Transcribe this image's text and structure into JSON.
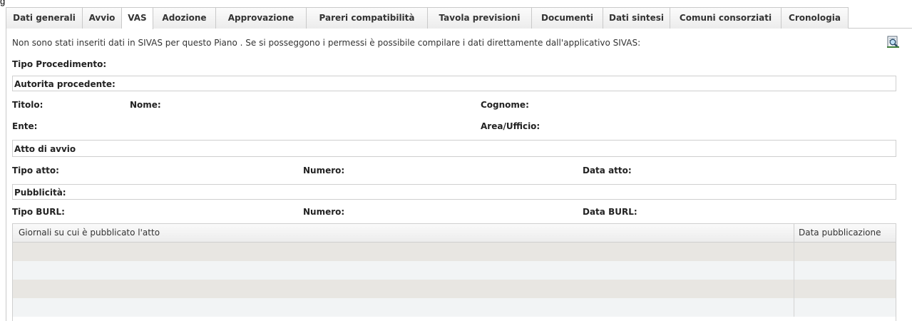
{
  "page_fragment": "g",
  "tabs": [
    {
      "label": "Dati generali",
      "active": false
    },
    {
      "label": "Avvio",
      "active": false
    },
    {
      "label": "VAS",
      "active": true
    },
    {
      "label": "Adozione",
      "active": false
    },
    {
      "label": "Approvazione",
      "active": false
    },
    {
      "label": "Pareri compatibilità",
      "active": false
    },
    {
      "label": "Tavola previsioni",
      "active": false
    },
    {
      "label": "Documenti",
      "active": false
    },
    {
      "label": "Dati sintesi",
      "active": false
    },
    {
      "label": "Comuni consorziati",
      "active": false
    },
    {
      "label": "Cronologia",
      "active": false
    }
  ],
  "notice": "Non sono stati inseriti dati in SIVAS per questo Piano . Se si posseggono i permessi è possibile compilare i dati direttamente dall'applicativo SIVAS:",
  "sivas_link_icon": "search-document-icon",
  "fields": {
    "tipo_procedimento": "Tipo Procedimento:",
    "autorita_procedente": "Autorita procedente:",
    "titolo": "Titolo:",
    "nome": "Nome:",
    "cognome": "Cognome:",
    "ente": "Ente:",
    "area_ufficio": "Area/Ufficio:",
    "atto_di_avvio": "Atto di avvio",
    "tipo_atto": "Tipo atto:",
    "numero_atto": "Numero:",
    "data_atto": "Data atto:",
    "pubblicita": "Pubblicità:",
    "tipo_burl": "Tipo BURL:",
    "numero_burl": "Numero:",
    "data_burl": "Data BURL:"
  },
  "grid": {
    "columns": [
      "Giornali su cui è pubblicato l'atto",
      "Data pubblicazione"
    ],
    "rows": [
      [
        "",
        ""
      ],
      [
        "",
        ""
      ],
      [
        "",
        ""
      ],
      [
        "",
        ""
      ]
    ]
  },
  "colors": {
    "border": "#c9c9c9",
    "row_alt_a": "#e8e6e2",
    "row_alt_b": "#f2f4f5"
  }
}
